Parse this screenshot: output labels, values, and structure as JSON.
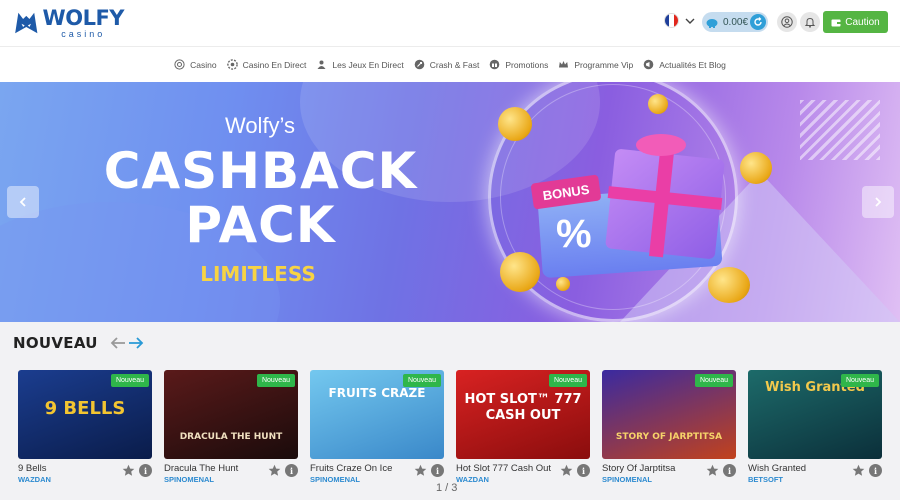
{
  "header": {
    "logo_main": "WOLFY",
    "logo_sub": "casino",
    "flag_colors": [
      "#1f3f9a",
      "#ffffff",
      "#e1261c"
    ],
    "wallet_amount": "0.00€",
    "deposit_label": "Caution"
  },
  "nav": {
    "items": [
      {
        "label": "Casino",
        "icon": "chip-icon"
      },
      {
        "label": "Casino En Direct",
        "icon": "live-chip-icon"
      },
      {
        "label": "Les Jeux En Direct",
        "icon": "dealer-icon"
      },
      {
        "label": "Crash & Fast",
        "icon": "rocket-icon"
      },
      {
        "label": "Promotions",
        "icon": "gift-icon"
      },
      {
        "label": "Programme Vip",
        "icon": "crown-icon"
      },
      {
        "label": "Actualités Et Blog",
        "icon": "megaphone-icon"
      }
    ]
  },
  "banner": {
    "subtitle": "Wolfy’s",
    "title": "CASHBACK PACK",
    "tagline": "LIMITLESS",
    "bonus_label": "BONUS",
    "percent_symbol": "%"
  },
  "new_section": {
    "title": "NOUVEAU",
    "pager": "1 / 3",
    "games": [
      {
        "name": "9 Bells",
        "provider": "WAZDAN",
        "badge": "Nouveau",
        "thumb_text": "9 BELLS",
        "thumb_colors": [
          "#1b3d8f",
          "#0a1c4a"
        ]
      },
      {
        "name": "Dracula The Hunt",
        "provider": "SPINOMENAL",
        "badge": "Nouveau",
        "thumb_text": "DRACULA THE HUNT",
        "thumb_colors": [
          "#5a1a1a",
          "#1a0b0b"
        ]
      },
      {
        "name": "Fruits Craze On Ice",
        "provider": "SPINOMENAL",
        "badge": "Nouveau",
        "thumb_text": "FRUITS CRAZE",
        "thumb_colors": [
          "#74c8ef",
          "#3a88c9"
        ]
      },
      {
        "name": "Hot Slot 777 Cash Out",
        "provider": "WAZDAN",
        "badge": "Nouveau",
        "thumb_text": "HOT SLOT™ 777 CASH OUT",
        "thumb_colors": [
          "#d82222",
          "#8a0d0d"
        ]
      },
      {
        "name": "Story Of Jarptitsa",
        "provider": "SPINOMENAL",
        "badge": "Nouveau",
        "thumb_text": "STORY OF JARPTITSA",
        "thumb_colors": [
          "#3a2aa0",
          "#c2421c"
        ]
      },
      {
        "name": "Wish Granted",
        "provider": "BETSOFT",
        "badge": "Nouveau",
        "thumb_text": "Wish Granted",
        "thumb_colors": [
          "#1d6b6a",
          "#0b2f3a"
        ]
      }
    ]
  }
}
